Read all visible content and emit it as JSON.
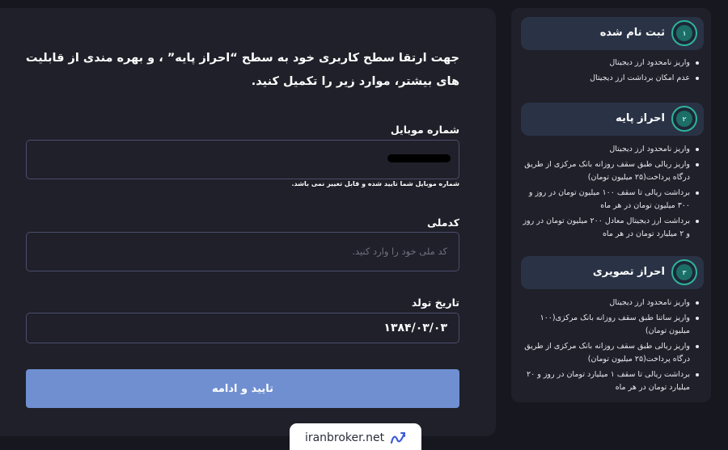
{
  "form": {
    "intro": "جهت ارتقا سطح کاربری خود به سطح “احراز پایه” ، و بهره مندی از قابلیت های بیشتر، موارد زیر را تکمیل کنید.",
    "mobile_label": "شماره موبایل",
    "mobile_value": "",
    "mobile_hint": "شماره موبایل شما تایید شده و قابل تغییر نمی باشد.",
    "national_code_label": "کدملی",
    "national_code_value": "",
    "national_code_placeholder": "کد ملی خود را وارد کنید.",
    "birth_date_label": "تاریخ تولد",
    "birth_date_value": "۱۳۸۴/۰۳/۰۳",
    "submit_label": "تایید و ادامه"
  },
  "levels": [
    {
      "title": "ثبت نام شده",
      "badge": "۱",
      "items": [
        "واریز نامحدود ارز دیجیتال",
        "عدم امکان برداشت ارز دیجیتال"
      ]
    },
    {
      "title": "احراز پایه",
      "badge": "۲",
      "items": [
        "واریز نامحدود ارز دیجیتال",
        "واریز ریالی طبق سقف روزانه بانک مرکزی از طریق درگاه پرداخت(۲۵ میلیون تومان)",
        "برداشت ریالی تا سقف ۱۰۰ میلیون تومان در روز و ۳۰۰ میلیون تومان در هر ماه",
        "برداشت ارز دیجیتال معادل ۲۰۰ میلیون تومان در روز و ۲ میلیارد تومان در هر ماه"
      ]
    },
    {
      "title": "احراز تصویری",
      "badge": "۳",
      "items": [
        "واریز نامحدود ارز دیجیتال",
        "واریز ساتنا طبق سقف روزانه بانک مرکزی(۱۰۰ میلیون تومان)",
        "واریز ریالی طبق سقف روزانه بانک مرکزی از طریق درگاه پرداخت(۲۵ میلیون تومان)",
        "برداشت ریالی تا سقف ۱ میلیارد تومان در روز و ۲۰ میلیارد تومان در هر ماه"
      ]
    }
  ],
  "watermark": {
    "text": "iranbroker.net",
    "icon": "chart-trend-icon"
  },
  "colors": {
    "background": "#17181f",
    "panel": "#1f2029",
    "input_border": "#4a4e6e",
    "button": "#6f8fd1",
    "level_header": "#2a3346",
    "level_icon_ring": "#2fb39b"
  }
}
